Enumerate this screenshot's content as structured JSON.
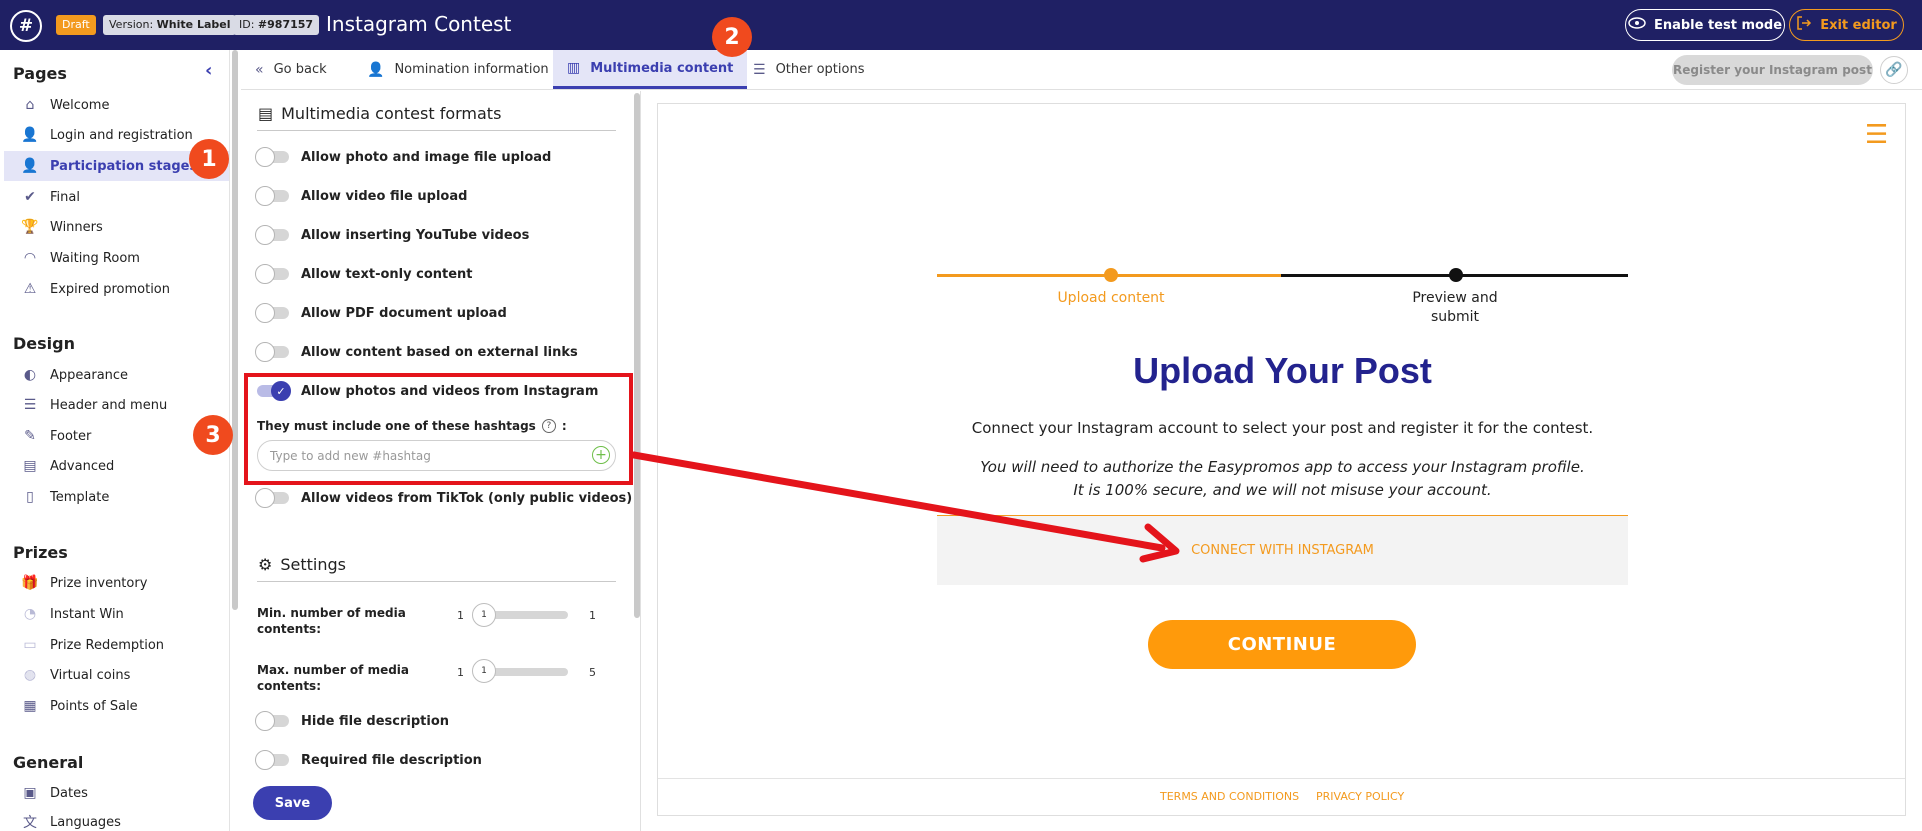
{
  "topbar": {
    "logo": "#",
    "badge_draft": "Draft",
    "version_prefix": "Version: ",
    "version_value": "White Label",
    "id_prefix": "ID: ",
    "id_value": "#987157",
    "title": "Instagram Contest",
    "test_mode_label": "Enable test mode",
    "exit_label": "Exit editor"
  },
  "sidebar": {
    "pages_heading": "Pages",
    "pages": [
      {
        "label": "Welcome",
        "icon": "home-icon"
      },
      {
        "label": "Login and registration",
        "icon": "user-plus-icon"
      },
      {
        "label": "Participation stages",
        "icon": "user-icon"
      },
      {
        "label": "Final",
        "icon": "check-icon"
      },
      {
        "label": "Winners",
        "icon": "trophy-icon"
      },
      {
        "label": "Waiting Room",
        "icon": "gauge-icon"
      },
      {
        "label": "Expired promotion",
        "icon": "warning-icon"
      }
    ],
    "design_heading": "Design",
    "design": [
      {
        "label": "Appearance",
        "icon": "palette-icon"
      },
      {
        "label": "Header and menu",
        "icon": "menu-icon"
      },
      {
        "label": "Footer",
        "icon": "brush-icon"
      },
      {
        "label": "Advanced",
        "icon": "code-icon"
      },
      {
        "label": "Template",
        "icon": "file-icon"
      }
    ],
    "prizes_heading": "Prizes",
    "prizes": [
      {
        "label": "Prize inventory",
        "icon": "gift-icon"
      },
      {
        "label": "Instant Win",
        "icon": "timer-icon"
      },
      {
        "label": "Prize Redemption",
        "icon": "redeem-icon"
      },
      {
        "label": "Virtual coins",
        "icon": "coins-icon"
      },
      {
        "label": "Points of Sale",
        "icon": "store-icon"
      }
    ],
    "general_heading": "General",
    "general": [
      {
        "label": "Dates",
        "icon": "calendar-icon"
      },
      {
        "label": "Languages",
        "icon": "language-icon"
      }
    ]
  },
  "tabs": [
    {
      "label": "Go back",
      "icon": "double-chevron-left-icon"
    },
    {
      "label": "Nomination information",
      "icon": "user-icon"
    },
    {
      "label": "Multimedia content",
      "icon": "layout-icon"
    },
    {
      "label": "Other options",
      "icon": "list-icon"
    }
  ],
  "register_button": "Register your Instagram post",
  "panel": {
    "formats_heading": "Multimedia contest formats",
    "formats": [
      {
        "label": "Allow photo and image file upload",
        "on": false
      },
      {
        "label": "Allow video file upload",
        "on": false
      },
      {
        "label": "Allow inserting YouTube videos",
        "on": false
      },
      {
        "label": "Allow text-only content",
        "on": false
      },
      {
        "label": "Allow PDF document upload",
        "on": false
      },
      {
        "label": "Allow content based on external links",
        "on": false
      },
      {
        "label": "Allow photos and videos from Instagram",
        "on": true
      }
    ],
    "hashtag_label": "They must include one of these hashtags",
    "hashtag_colon": ":",
    "hashtag_help": "?",
    "hashtag_placeholder": "Type to add new #hashtag",
    "tiktok_label": "Allow videos from TikTok (only public videos)",
    "settings_heading": "Settings",
    "sliders": [
      {
        "label": "Min. number of media contents:",
        "min": "1",
        "value": "1",
        "max": "1"
      },
      {
        "label": "Max. number of media contents:",
        "min": "1",
        "value": "1",
        "max": "5"
      }
    ],
    "hide_description": "Hide file description",
    "required_description": "Required file description",
    "save": "Save"
  },
  "preview": {
    "step1": "Upload content",
    "step2": "Preview and submit",
    "title": "Upload Your Post",
    "subtitle": "Connect your Instagram account to select your post and register it for the contest.",
    "note": "You will need to authorize the Easypromos app to access your Instagram profile. It is 100% secure, and we will not misuse your account.",
    "connect": "CONNECT WITH INSTAGRAM",
    "continue": "CONTINUE",
    "terms": "TERMS AND CONDITIONS",
    "privacy": "PRIVACY POLICY"
  },
  "markers": [
    "1",
    "2",
    "3"
  ],
  "colors": {
    "topbar": "#1f2064",
    "accent": "#3b3fb0",
    "orange": "#f39a1e",
    "annotation_red": "#e4141b",
    "marker": "#f04a1e",
    "title_blue": "#23238e"
  }
}
